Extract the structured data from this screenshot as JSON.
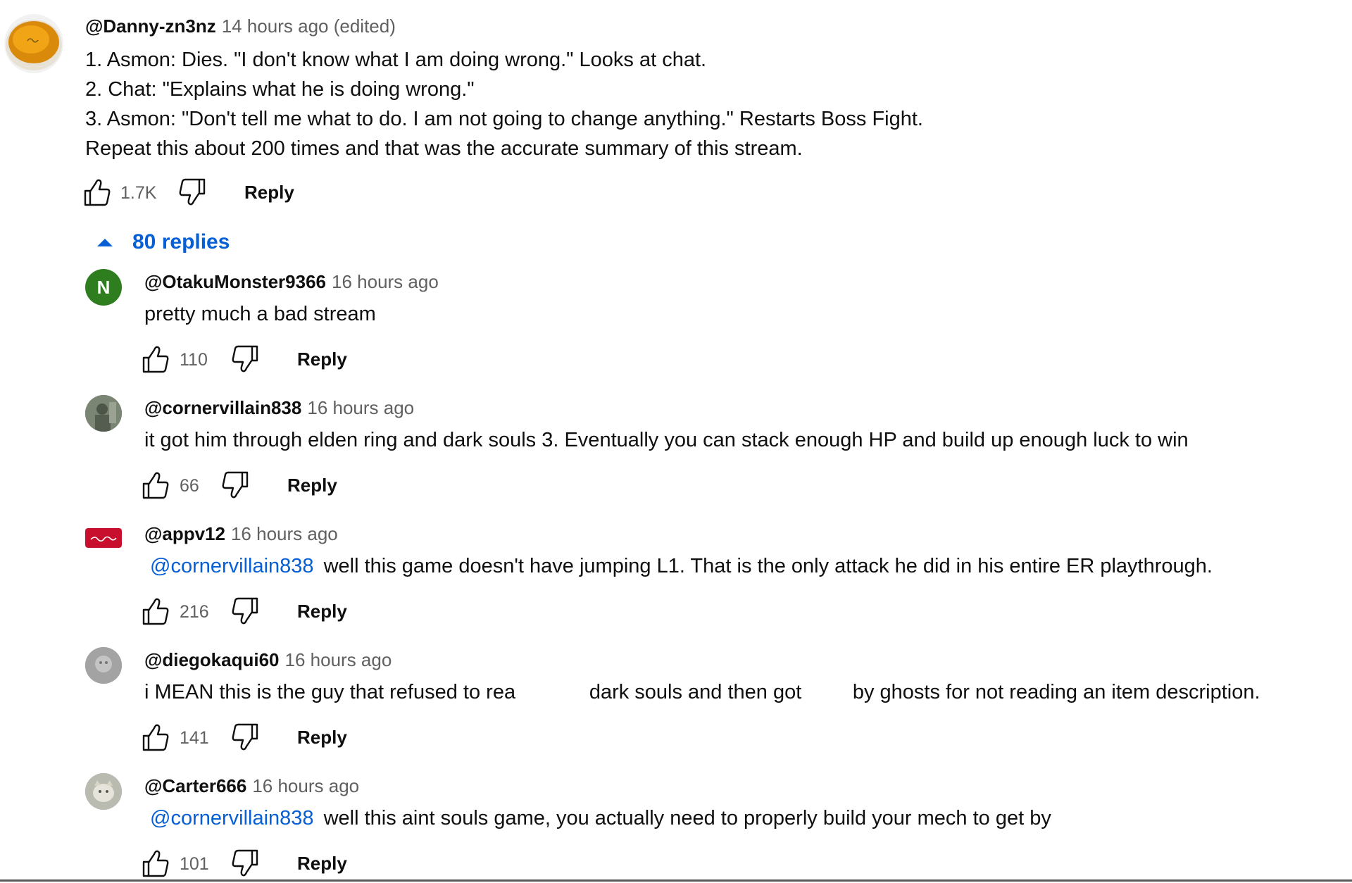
{
  "colors": {
    "link": "#065fd4",
    "meta": "#606060",
    "text": "#0f0f0f"
  },
  "top_comment": {
    "author": "@Danny-zn3nz",
    "time": "14 hours ago (edited)",
    "lines": [
      "1. Asmon: Dies. \"I don't know what I am doing wrong.\" Looks at chat.",
      "2. Chat: \"Explains what he is doing wrong.\"",
      "3. Asmon: \"Don't tell me what to do. I am not going to change anything.\" Restarts Boss Fight.",
      "Repeat this about 200 times and that was the accurate summary of this stream."
    ],
    "likes": "1.7K",
    "reply_label": "Reply",
    "avatar_icon": "soup-bowl-avatar"
  },
  "replies_toggle": {
    "label": "80 replies",
    "icon": "caret-up-icon"
  },
  "replies": [
    {
      "author": "@OtakuMonster9366",
      "time": "16 hours ago",
      "mention": "",
      "text": "pretty much a bad stream",
      "likes": "110",
      "reply_label": "Reply",
      "avatar_letter": "N",
      "avatar_color": "#2e7d1f"
    },
    {
      "author": "@cornervillain838",
      "time": "16 hours ago",
      "mention": "",
      "text": "it got him through elden ring and dark souls 3. Eventually you can stack enough HP and build up enough luck to win",
      "likes": "66",
      "reply_label": "Reply",
      "avatar_letter": "",
      "avatar_color": "#6f7a6a"
    },
    {
      "author": "@appv12",
      "time": "16 hours ago",
      "mention": "@cornervillain838",
      "text": "well this game doesn't have jumping L1.  That is the only attack he did in his entire ER playthrough.",
      "likes": "216",
      "reply_label": "Reply",
      "avatar_letter": "",
      "avatar_color": "#c8102e"
    },
    {
      "author": "@diegokaqui60",
      "time": "16 hours ago",
      "mention": "",
      "text": "i MEAN this is the guy that refused to rea             dark souls and then got         by ghosts for not reading an item description.",
      "likes": "141",
      "reply_label": "Reply",
      "avatar_letter": "",
      "avatar_color": "#9a9a9a"
    },
    {
      "author": "@Carter666",
      "time": "16 hours ago",
      "mention": "@cornervillain838",
      "text": "well this aint souls game, you actually need to properly build your mech to get by",
      "likes": "101",
      "reply_label": "Reply",
      "avatar_letter": "",
      "avatar_color": "#a7a89e"
    }
  ]
}
